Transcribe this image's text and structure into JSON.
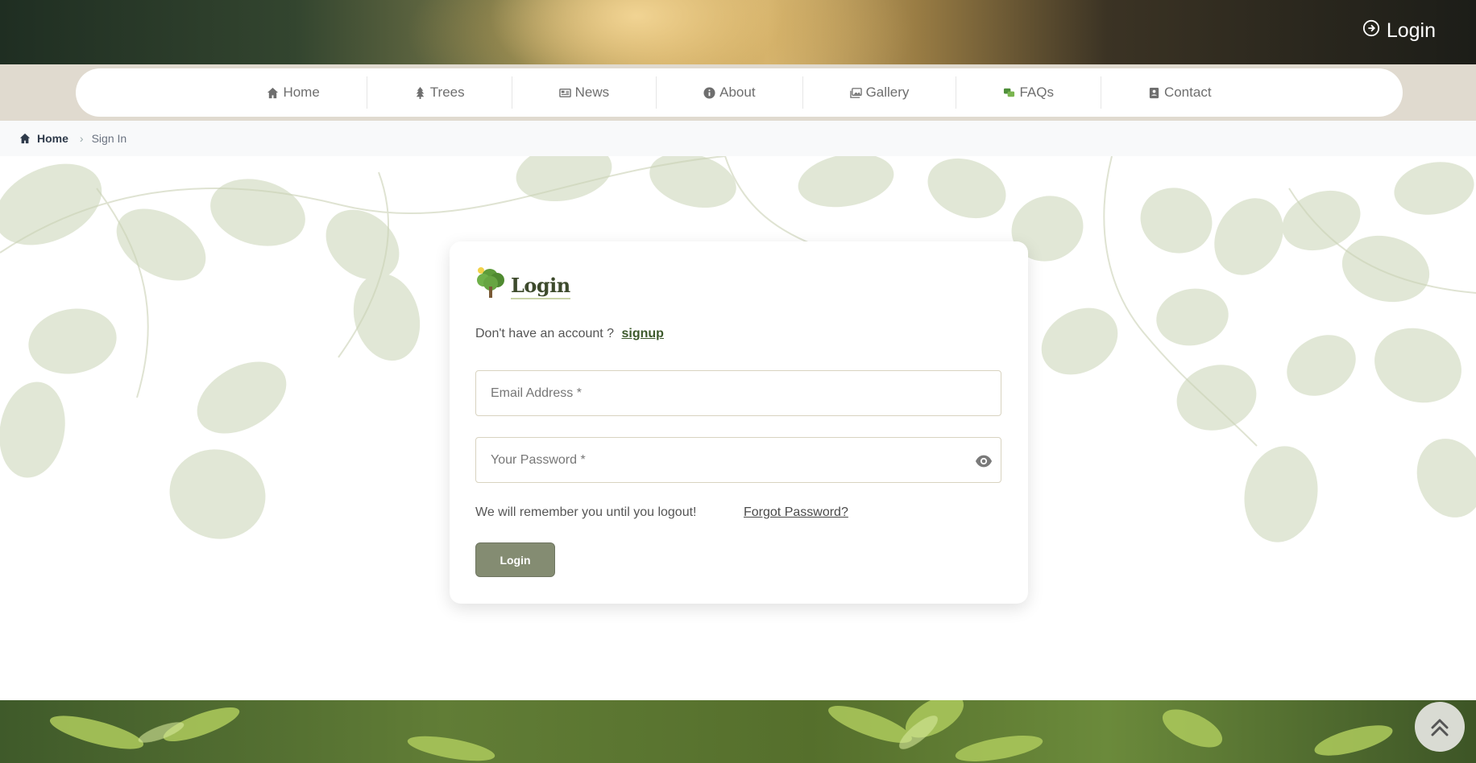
{
  "header": {
    "login_label": "Login",
    "login_icon": "sign-in-icon"
  },
  "nav": {
    "items": [
      {
        "label": "Home",
        "icon": "home-icon"
      },
      {
        "label": "Trees",
        "icon": "tree-icon"
      },
      {
        "label": "News",
        "icon": "newspaper-icon"
      },
      {
        "label": "About",
        "icon": "info-circle-icon"
      },
      {
        "label": "Gallery",
        "icon": "images-icon"
      },
      {
        "label": "FAQs",
        "icon": "comments-icon"
      },
      {
        "label": "Contact",
        "icon": "address-book-icon"
      }
    ]
  },
  "breadcrumb": {
    "home": "Home",
    "current": "Sign In"
  },
  "login_card": {
    "title": "Login",
    "no_account_text": "Don't have an account ?",
    "signup_label": "signup",
    "email_placeholder": "Email Address *",
    "password_placeholder": "Your Password *",
    "remember_text": "We will remember you until you logout!",
    "forgot_label": "Forgot Password?",
    "submit_label": "Login"
  },
  "colors": {
    "nav_strip": "#e0dacf",
    "button": "#848c72",
    "title": "#3d4a2c",
    "signup": "#3d5a2c"
  }
}
